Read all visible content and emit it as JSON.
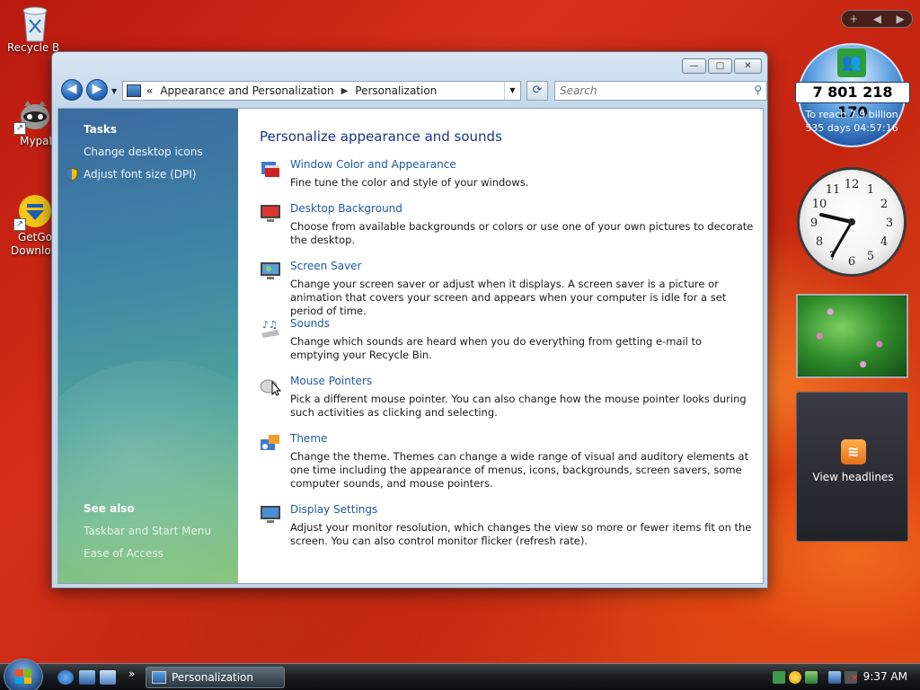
{
  "desktop": {
    "icons": [
      {
        "label": "Recycle Bin"
      },
      {
        "label": "Mypal"
      },
      {
        "label": "GetGo Download"
      }
    ]
  },
  "window": {
    "controls": {
      "minimize": "—",
      "maximize": "□",
      "close": "✕"
    },
    "nav": {
      "back": "◀",
      "forward": "▶"
    },
    "breadcrumb": {
      "prefix": "«",
      "parent": "Appearance and Personalization",
      "separator": "▶",
      "current": "Personalization"
    },
    "search": {
      "placeholder": "Search"
    },
    "sidebar": {
      "tasks_header": "Tasks",
      "tasks": [
        "Change desktop icons",
        "Adjust font size (DPI)"
      ],
      "see_also_header": "See also",
      "see_also": [
        "Taskbar and Start Menu",
        "Ease of Access"
      ]
    },
    "main": {
      "title": "Personalize appearance and sounds",
      "items": [
        {
          "link": "Window Color and Appearance",
          "desc": "Fine tune the color and style of your windows.",
          "icon": "window-color-icon"
        },
        {
          "link": "Desktop Background",
          "desc": "Choose from available backgrounds or colors or use one of your own pictures to decorate the desktop.",
          "icon": "desktop-background-icon"
        },
        {
          "link": "Screen Saver",
          "desc": "Change your screen saver or adjust when it displays. A screen saver is a picture or animation that covers your screen and appears when your computer is idle for a set period of time.",
          "icon": "screen-saver-icon"
        },
        {
          "link": "Sounds",
          "desc": "Change which sounds are heard when you do everything from getting e-mail to emptying your Recycle Bin.",
          "icon": "sounds-icon"
        },
        {
          "link": "Mouse Pointers",
          "desc": "Pick a different mouse pointer. You can also change how the mouse pointer looks during such activities as clicking and selecting.",
          "icon": "mouse-pointer-icon"
        },
        {
          "link": "Theme",
          "desc": "Change the theme. Themes can change a wide range of visual and auditory elements at one time including the appearance of menus, icons, backgrounds, screen savers, some computer sounds, and mouse pointers.",
          "icon": "theme-icon"
        },
        {
          "link": "Display Settings",
          "desc": "Adjust your monitor resolution, which changes the view so more or fewer items fit on the screen. You can also control monitor flicker (refresh rate).",
          "icon": "display-settings-icon"
        }
      ]
    }
  },
  "gadgets": {
    "bar": {
      "add": "+",
      "prev": "◀",
      "next": "▶"
    },
    "population": {
      "count": "7 801 218 170",
      "line1": "To reach 7.9 billion",
      "line2": "535 days 04:57:16"
    },
    "feeds": {
      "label": "View headlines"
    },
    "clock_numbers": [
      "12",
      "1",
      "2",
      "3",
      "4",
      "5",
      "6",
      "7",
      "8",
      "9",
      "10",
      "11"
    ]
  },
  "taskbar": {
    "active_window": "Personalization",
    "time": "9:37 AM",
    "more": "»"
  },
  "colors": {
    "link": "#1e5aa5",
    "title": "#1e3287",
    "sidebar_top": "#3b6aa0",
    "sidebar_bottom": "#8bc57f"
  }
}
